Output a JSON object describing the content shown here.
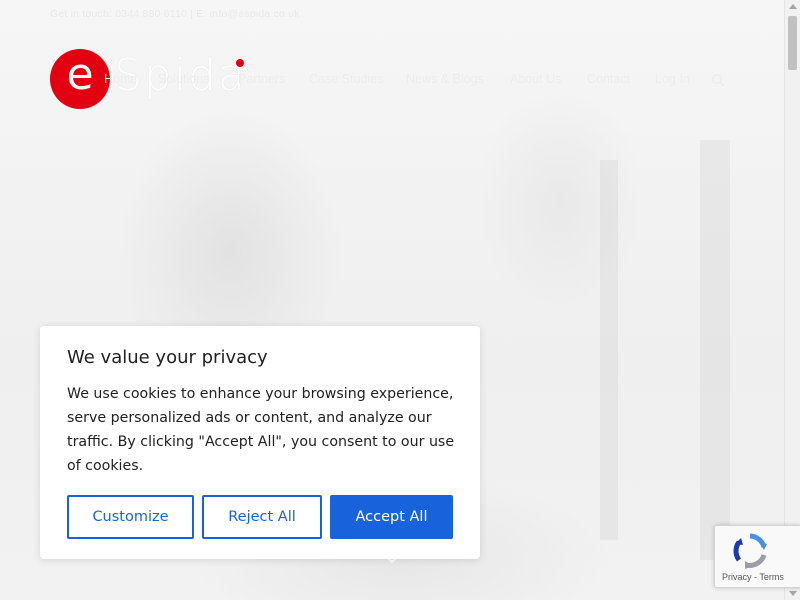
{
  "topbar": {
    "contact": "Get in touch: 0344 880 6110  |  E: info@espida.co.uk"
  },
  "brand": {
    "logo_letter": "e",
    "logo_word": "Spida",
    "accent_color": "#e30010"
  },
  "nav": {
    "items": [
      {
        "label": "Home"
      },
      {
        "label": "Solutions"
      },
      {
        "label": "Partners"
      },
      {
        "label": "Case Studies"
      },
      {
        "label": "News & Blogs"
      },
      {
        "label": "About Us"
      },
      {
        "label": "Contact"
      },
      {
        "label": "Log In"
      }
    ],
    "search_icon": "search-icon"
  },
  "cookie_banner": {
    "title": "We value your privacy",
    "body": "We use cookies to enhance your browsing experience, serve personalized ads or content, and analyze our traffic. By clicking \"Accept All\", you consent to our use of cookies.",
    "customize_label": "Customize",
    "reject_label": "Reject All",
    "accept_label": "Accept All",
    "button_color": "#1863dc"
  },
  "recaptcha": {
    "links": "Privacy - Terms"
  }
}
